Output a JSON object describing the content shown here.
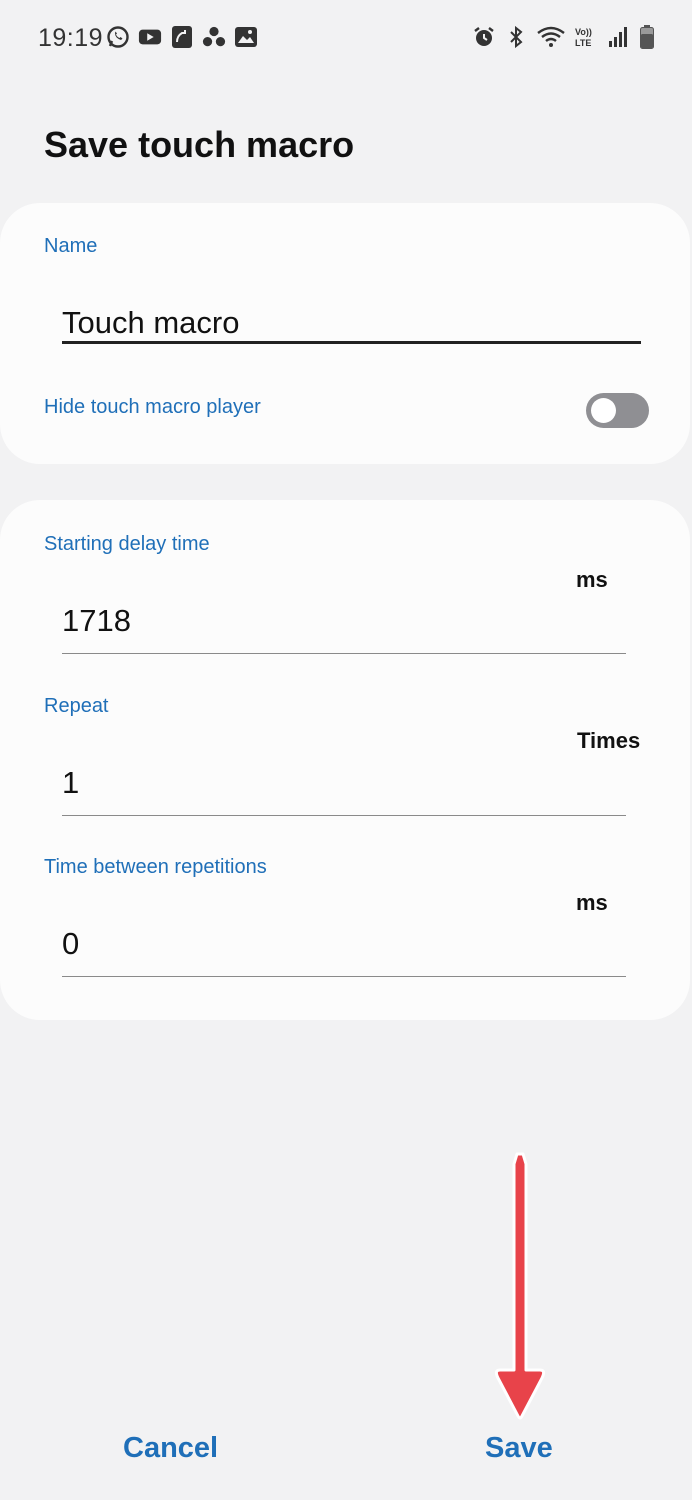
{
  "status_bar": {
    "time": "19:19",
    "left_icons": [
      "whatsapp-icon",
      "youtube-icon",
      "missed-call-icon",
      "dots-app-icon",
      "gallery-icon"
    ],
    "right_icons": [
      "alarm-icon",
      "bluetooth-icon",
      "wifi-icon",
      "volte-icon",
      "signal-icon",
      "battery-icon"
    ],
    "volte_text": "Vo)) LTE"
  },
  "title": "Save touch macro",
  "name_card": {
    "label": "Name",
    "value": "Touch macro",
    "hide_player_label": "Hide touch macro player",
    "hide_player_enabled": false
  },
  "settings_card": {
    "starting_delay": {
      "label": "Starting delay time",
      "value": "1718",
      "unit": "ms"
    },
    "repeat": {
      "label": "Repeat",
      "value": "1",
      "unit": "Times"
    },
    "time_between": {
      "label": "Time between repetitions",
      "value": "0",
      "unit": "ms"
    }
  },
  "buttons": {
    "cancel": "Cancel",
    "save": "Save"
  },
  "colors": {
    "accent": "#1f6fb8",
    "background": "#f2f2f3",
    "card": "#fcfcfc",
    "toggle_off": "#8f8f93",
    "annotation": "#e8434a"
  }
}
